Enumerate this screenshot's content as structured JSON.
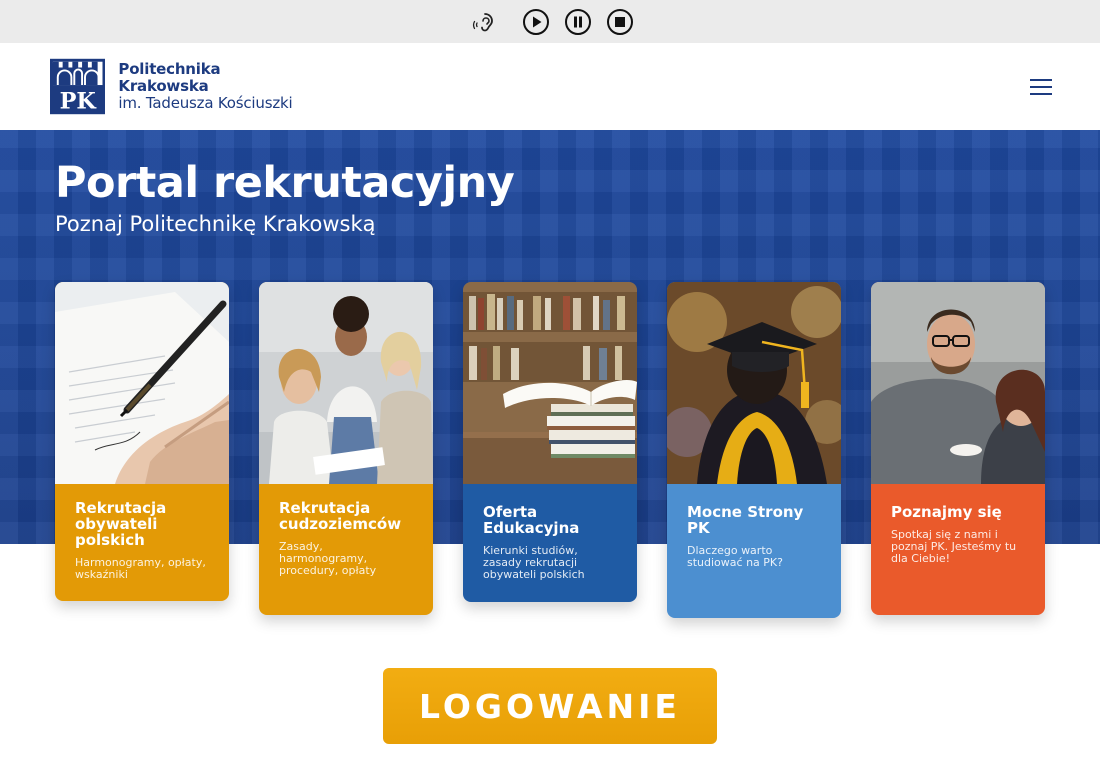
{
  "a11y": {
    "icons": [
      "ear-icon",
      "play-icon",
      "pause-icon",
      "stop-icon"
    ]
  },
  "header": {
    "logo_mark_text": "PK",
    "logo_line1": "Politechnika Krakowska",
    "logo_line2": "im. Tadeusza Kościuszki",
    "menu_icon": "hamburger-icon"
  },
  "hero": {
    "title": "Portal rekrutacyjny",
    "subtitle": "Poznaj Politechnikę Krakowską"
  },
  "cards": [
    {
      "title": "Rekrutacja obywateli polskich",
      "desc": "Harmonogramy, opłaty, wskaźniki",
      "color": "#e39a06",
      "image": "hand-signing-document"
    },
    {
      "title": "Rekrutacja cudzoziemców",
      "desc": "Zasady, harmonogramy, procedury, opłaty",
      "color": "#e39a06",
      "image": "students-studying-together"
    },
    {
      "title": "Oferta Edukacyjna",
      "desc": "Kierunki studiów, zasady rekrutacji obywateli polskich",
      "color": "#1f5ba4",
      "image": "books-stack-library"
    },
    {
      "title": "Mocne Strony PK",
      "desc": "Dlaczego warto studiować na PK?",
      "color": "#4c8fd0",
      "image": "graduate-cap"
    },
    {
      "title": "Poznajmy się",
      "desc": "Spotkaj się z nami i poznaj PK. Jesteśmy tu dla Ciebie!",
      "color": "#ea5a2b",
      "image": "people-meeting"
    }
  ],
  "login": {
    "label": "LOGOWANIE"
  },
  "colors": {
    "brand_blue": "#1d3b80",
    "hero_blue": "#1d4699",
    "orange": "#e39a06",
    "blue_dark": "#1f5ba4",
    "blue_light": "#4c8fd0",
    "red_orange": "#ea5a2b"
  }
}
